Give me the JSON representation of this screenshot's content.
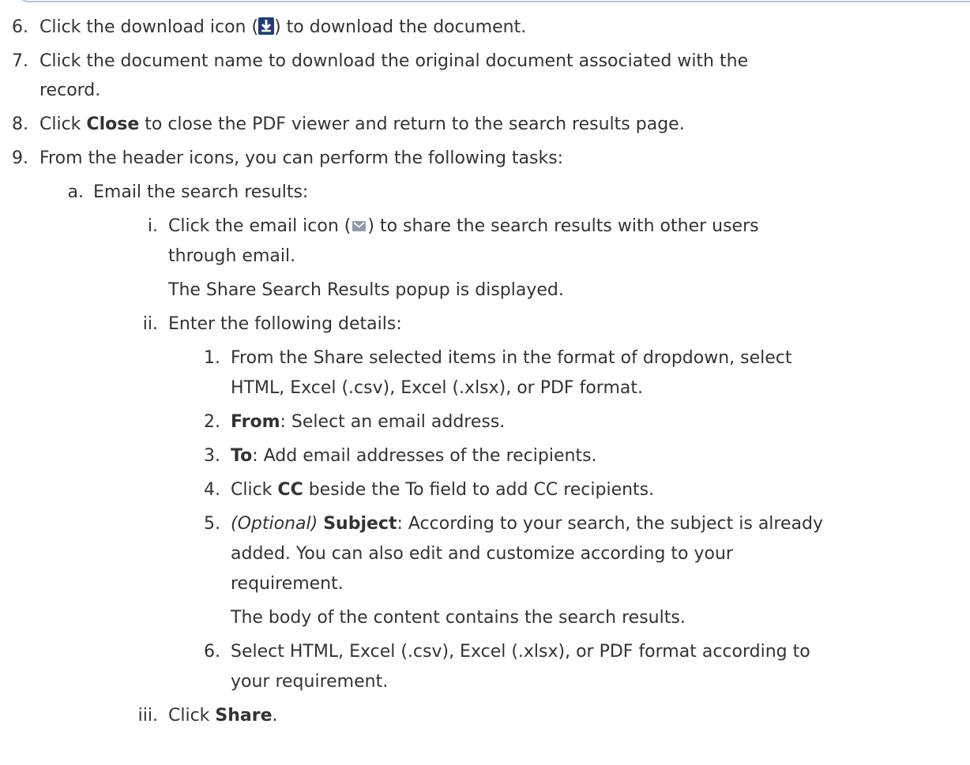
{
  "steps": {
    "s6": {
      "num": "6.",
      "pre": "Click the download icon (",
      "post": ") to download the document.",
      "icon": "download-icon"
    },
    "s7": {
      "num": "7.",
      "line1": "Click the document name to download the original document associated with the",
      "line2": "record."
    },
    "s8": {
      "num": "8.",
      "pre": "Click ",
      "bold": "Close",
      "post": " to close the PDF viewer and return to the search results page."
    },
    "s9": {
      "num": "9.",
      "text": "From the header icons, you can perform the following tasks:"
    },
    "a": {
      "num": "a.",
      "text": "Email the search results:"
    },
    "i": {
      "num": "i.",
      "pre": "Click the email icon (",
      "post": ") to share the search results with other users",
      "line2": "through email.",
      "line3": "The Share Search Results popup is displayed.",
      "icon": "email-icon"
    },
    "ii": {
      "num": "ii.",
      "text": "Enter the following details:"
    },
    "sub1": {
      "num": "1.",
      "line1": "From the Share selected items in the format of dropdown, select",
      "line2": "HTML, Excel (.csv), Excel (.xlsx), or PDF format."
    },
    "sub2": {
      "num": "2.",
      "bold": "From",
      "post": ": Select an email address."
    },
    "sub3": {
      "num": "3.",
      "bold": "To",
      "post": ": Add email addresses of the recipients."
    },
    "sub4": {
      "num": "4.",
      "pre": "Click ",
      "bold": "CC",
      "post": " beside the To field to add CC recipients."
    },
    "sub5": {
      "num": "5.",
      "ital": "(Optional)",
      "bold": "Subject",
      "post": ": According to your search, the subject is already",
      "line2": "added. You can also edit and customize according to your",
      "line3": "requirement.",
      "line4": "The body of the content contains the search results."
    },
    "sub6": {
      "num": "6.",
      "line1": "Select HTML, Excel (.csv), Excel (.xlsx), or PDF format according to",
      "line2": "your requirement."
    },
    "iii": {
      "num": "iii.",
      "pre": "Click ",
      "bold": "Share",
      "post": "."
    }
  }
}
